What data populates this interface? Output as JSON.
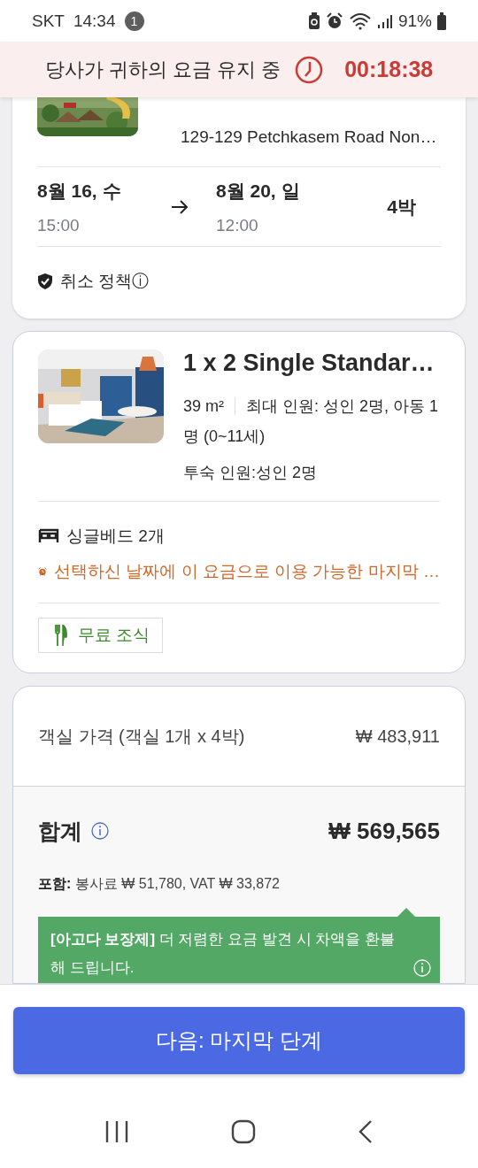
{
  "status_bar": {
    "carrier": "SKT",
    "time": "14:34",
    "notification_count": "1",
    "battery": "91%"
  },
  "hold_banner": {
    "text": "당사가 귀하의 요금 유지 중",
    "timer": "00:18:38"
  },
  "hotel": {
    "address": "129-129 Petchkasem Road Non…"
  },
  "stay": {
    "check_in": {
      "date": "8월 16, 수",
      "time": "15:00"
    },
    "check_out": {
      "date": "8월 20, 일",
      "time": "12:00"
    },
    "nights": "4박",
    "policy": "취소 정책ⓘ"
  },
  "room": {
    "title": "1 x 2 Single Standar…",
    "size": "39 m²",
    "occupancy": "최대 인원: 성인 2명, 아동 1 명 (0~11세)",
    "guests": "투숙 인원:성인 2명",
    "bed": "싱글베드 2개",
    "urgency": "선택하신 날짜에 이 요금으로 이용 가능한 마지막 …",
    "perk": "무료 조식"
  },
  "price": {
    "room_label": "객실 가격 (객실 1개 x 4박)",
    "room_price": "₩ 483,911",
    "total_label": "합계",
    "total": "₩ 569,565",
    "includes": "**포함:** 봉사료 ₩ 51,780, VAT ₩ 33,872",
    "guarantee": "**[아고다 보장제]** 더 저렴한 요금 발견 시 차액을 환불해 드립니다."
  },
  "next_button": "다음: 마지막 단계"
}
